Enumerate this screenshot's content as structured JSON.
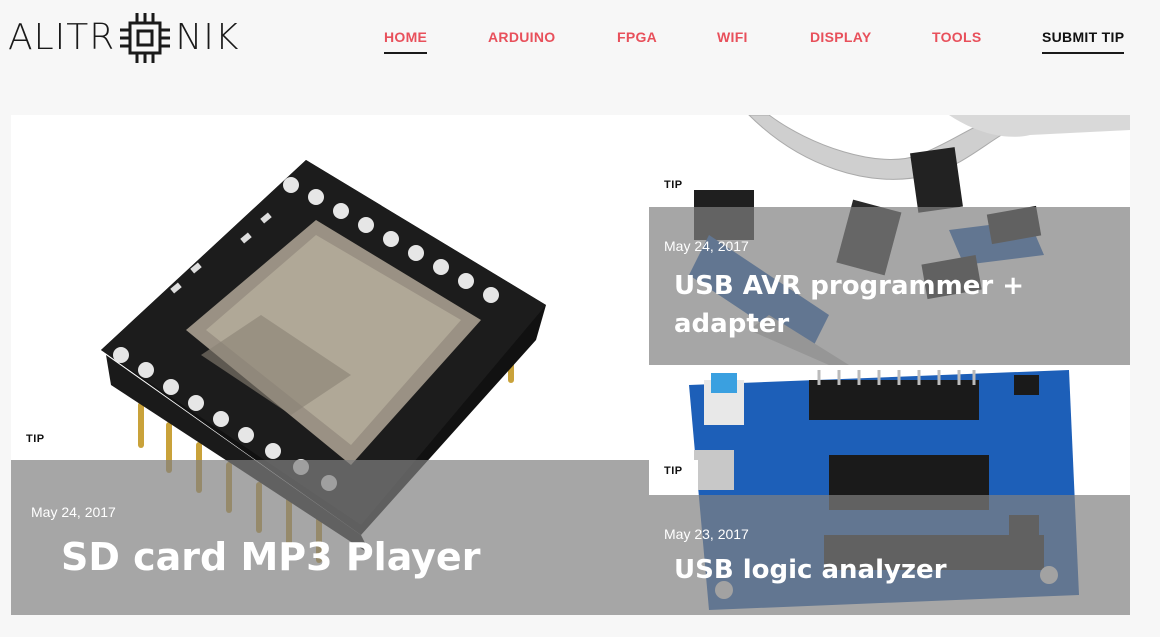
{
  "header": {
    "logo_left": "ALITR",
    "logo_right": "NIK",
    "nav": [
      {
        "label": "HOME"
      },
      {
        "label": "ARDUINO"
      },
      {
        "label": "FPGA"
      },
      {
        "label": "WIFI"
      },
      {
        "label": "DISPLAY"
      },
      {
        "label": "TOOLS"
      },
      {
        "label": "SUBMIT TIP"
      }
    ]
  },
  "posts": [
    {
      "tag": "TIP",
      "date": "May 24, 2017",
      "title": "SD card MP3 Player",
      "image_icon": "mp3-module-image"
    },
    {
      "tag": "TIP",
      "date": "May 24, 2017",
      "title_line1": "USB AVR programmer +",
      "title_line2": "adapter",
      "image_icon": "avr-programmer-image"
    },
    {
      "tag": "TIP",
      "date": "May 23, 2017",
      "title": "USB logic analyzer",
      "image_icon": "logic-analyzer-image"
    }
  ],
  "colors": {
    "nav_accent": "#e8505b",
    "overlay": "#808080",
    "background": "#f7f7f7",
    "pcb_blue": "#1d5fb8"
  }
}
